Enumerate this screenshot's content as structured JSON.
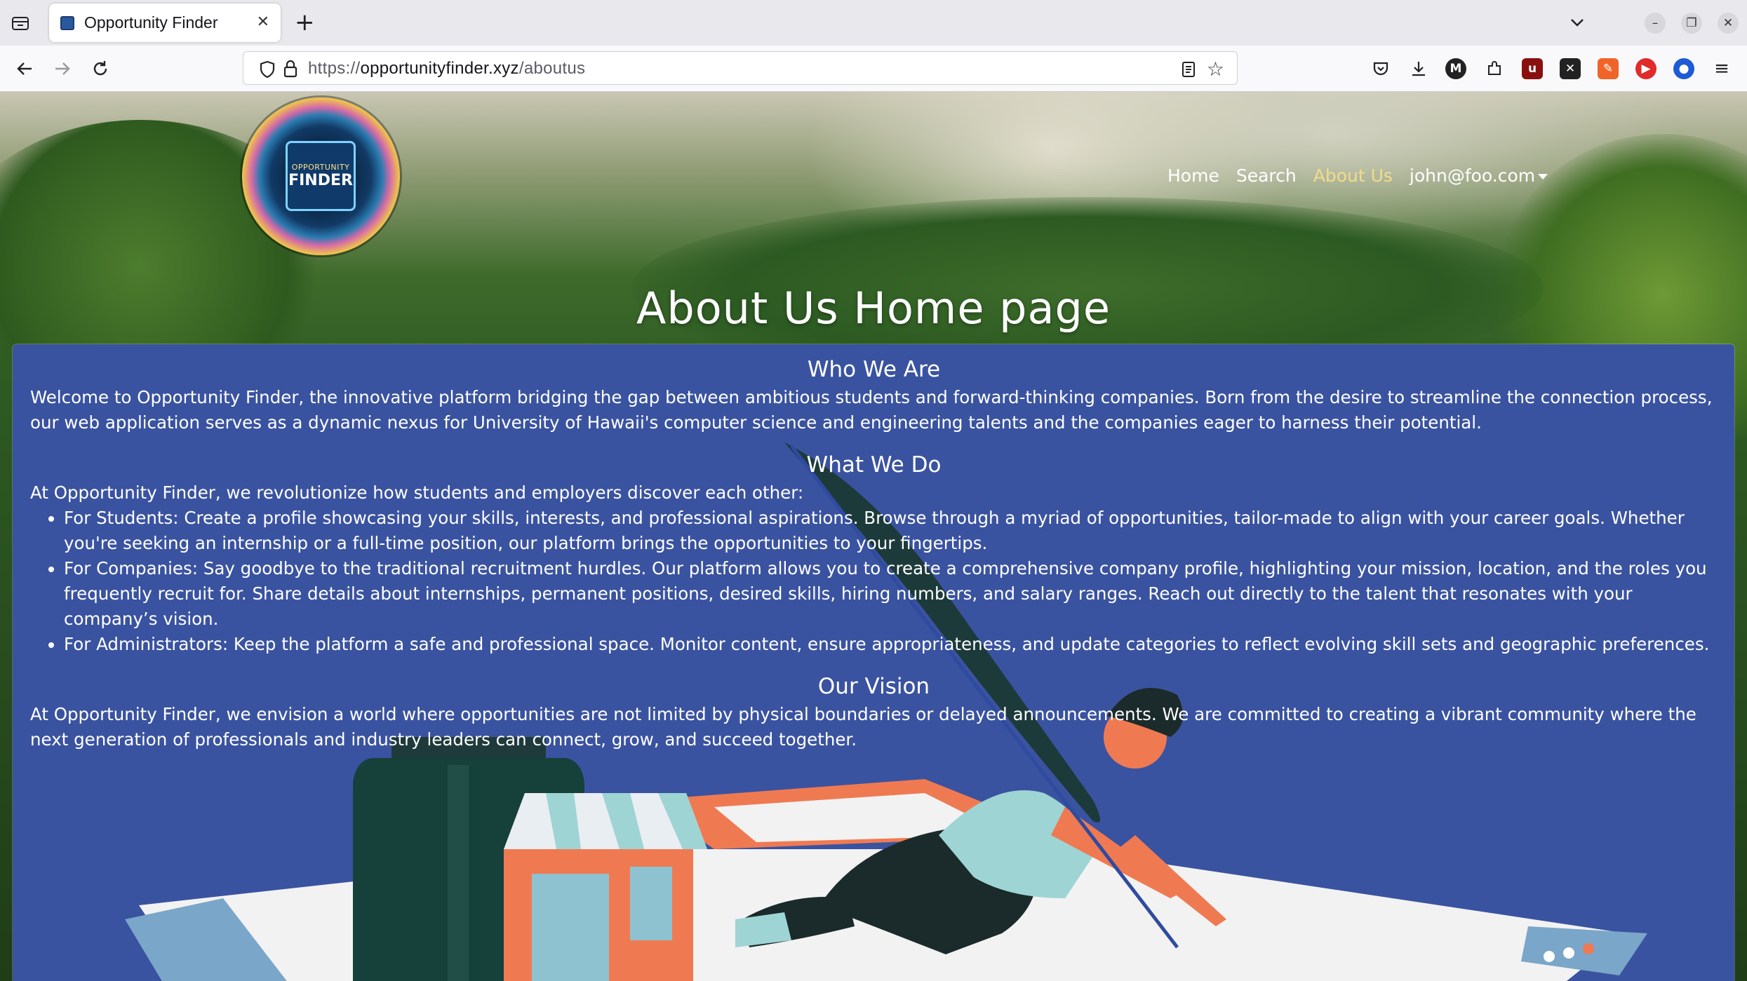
{
  "browser": {
    "tab_title": "Opportunity Finder",
    "url_scheme": "https://",
    "url_host": "opportunityfinder.xyz",
    "url_path": "/aboutus"
  },
  "site": {
    "logo_line1": "OPPORTUNITY",
    "logo_line2": "FINDER",
    "nav": {
      "home": "Home",
      "search": "Search",
      "about": "About Us",
      "user": "john@foo.com"
    },
    "active_color": "#f2dc8c",
    "panel_color": "#3a53a0"
  },
  "page": {
    "title": "About Us Home page",
    "who_heading": "Who We Are",
    "who_text": "Welcome to Opportunity Finder, the innovative platform bridging the gap between ambitious students and forward-thinking companies. Born from the desire to streamline the connection process, our web application serves as a dynamic nexus for University of Hawaii's computer science and engineering talents and the companies eager to harness their potential.",
    "what_heading": "What We Do",
    "what_intro": "At Opportunity Finder, we revolutionize how students and employers discover each other:",
    "items": [
      {
        "label": "For Students:",
        "text": " Create a profile showcasing your skills, interests, and professional aspirations. Browse through a myriad of opportunities, tailor-made to align with your career goals. Whether you're seeking an internship or a full-time position, our platform brings the opportunities to your fingertips."
      },
      {
        "label": "For Companies:",
        "text": " Say goodbye to the traditional recruitment hurdles. Our platform allows you to create a comprehensive company profile, highlighting your mission, location, and the roles you frequently recruit for. Share details about internships, permanent positions, desired skills, hiring numbers, and salary ranges. Reach out directly to the talent that resonates with your company’s vision."
      },
      {
        "label": "For Administrators:",
        "text": " Keep the platform a safe and professional space. Monitor content, ensure appropriateness, and update categories to reflect evolving skill sets and geographic preferences."
      }
    ],
    "vision_heading": "Our Vision",
    "vision_text": "At Opportunity Finder, we envision a world where opportunities are not limited by physical boundaries or delayed announcements. We are committed to creating a vibrant community where the next generation of professionals and industry leaders can connect, grow, and succeed together."
  }
}
